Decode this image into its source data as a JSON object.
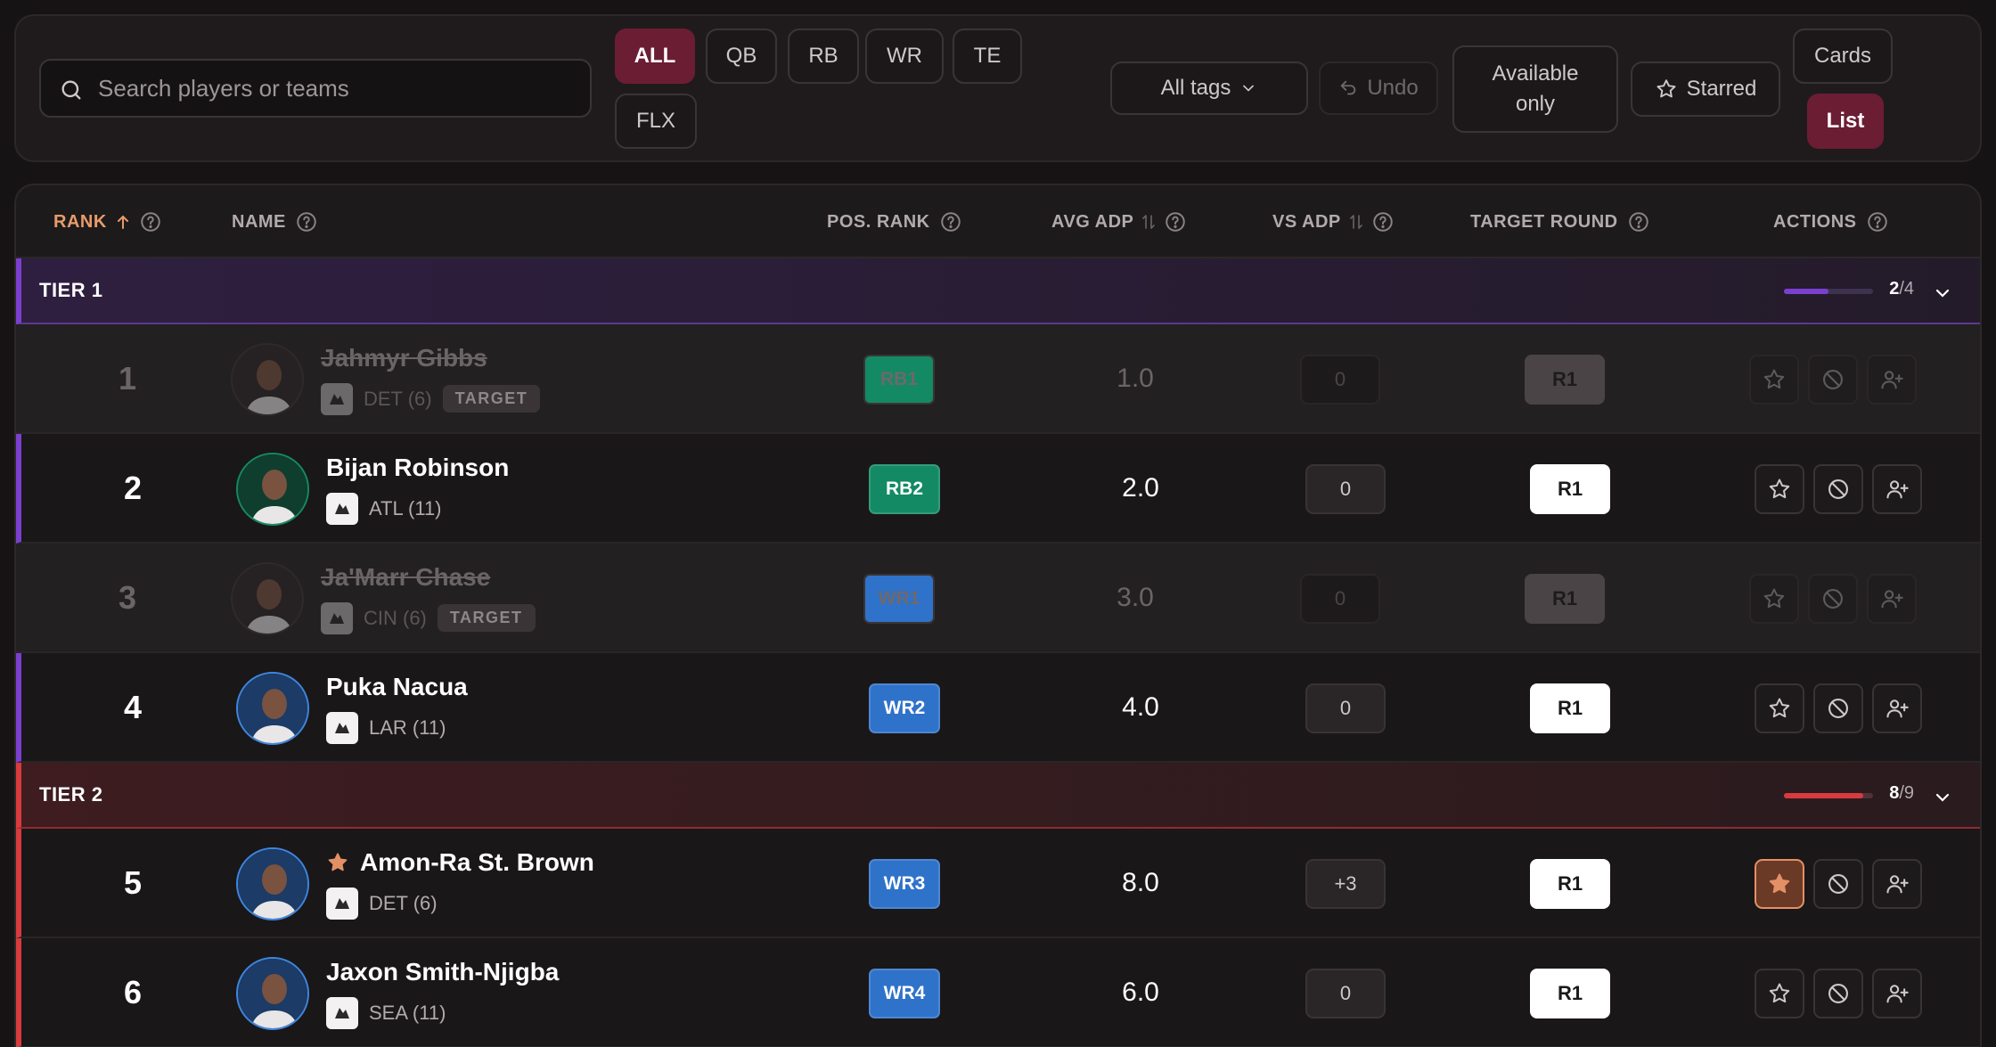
{
  "search": {
    "placeholder": "Search players or teams",
    "icon": "search-icon"
  },
  "filters": {
    "positions": [
      "ALL",
      "QB",
      "RB",
      "WR",
      "TE",
      "FLX"
    ],
    "active": "ALL"
  },
  "toolbar": {
    "tags_label": "All tags",
    "undo_label": "Undo",
    "available_label": "Available only",
    "starred_label": "Starred",
    "view_cards_label": "Cards",
    "view_list_label": "List",
    "active_view": "List"
  },
  "columns": {
    "rank": "RANK",
    "name": "NAME",
    "pos_rank": "POS. RANK",
    "avg_adp": "AVG ADP",
    "vs_adp": "VS ADP",
    "target_round": "TARGET ROUND",
    "actions": "ACTIONS"
  },
  "colors": {
    "accent": "#6b1d34",
    "tier1": "#7b3fd0",
    "tier2": "#d83a3e",
    "rb": "#138a63",
    "wr": "#2f72c9",
    "star": "#e39066"
  },
  "tiers": [
    {
      "label": "TIER 1",
      "drafted": "2",
      "total": "/4",
      "fraction": 0.5,
      "players": [
        {
          "rank": "1",
          "name": "Jahmyr Gibbs",
          "team": "DET (6)",
          "tag": "TARGET",
          "pos": "RB1",
          "adp": "1.0",
          "vs": "0",
          "round": "R1",
          "drafted": true,
          "starred": false
        },
        {
          "rank": "2",
          "name": "Bijan Robinson",
          "team": "ATL (11)",
          "tag": "",
          "pos": "RB2",
          "adp": "2.0",
          "vs": "0",
          "round": "R1",
          "drafted": false,
          "starred": false
        },
        {
          "rank": "3",
          "name": "Ja'Marr Chase",
          "team": "CIN (6)",
          "tag": "TARGET",
          "pos": "WR1",
          "adp": "3.0",
          "vs": "0",
          "round": "R1",
          "drafted": true,
          "starred": false
        },
        {
          "rank": "4",
          "name": "Puka Nacua",
          "team": "LAR (11)",
          "tag": "",
          "pos": "WR2",
          "adp": "4.0",
          "vs": "0",
          "round": "R1",
          "drafted": false,
          "starred": false
        }
      ]
    },
    {
      "label": "TIER 2",
      "drafted": "8",
      "total": "/9",
      "fraction": 0.889,
      "players": [
        {
          "rank": "5",
          "name": "Amon-Ra St. Brown",
          "team": "DET (6)",
          "tag": "",
          "pos": "WR3",
          "adp": "8.0",
          "vs": "+3",
          "round": "R1",
          "drafted": false,
          "starred": true
        },
        {
          "rank": "6",
          "name": "Jaxon Smith-Njigba",
          "team": "SEA (11)",
          "tag": "",
          "pos": "WR4",
          "adp": "6.0",
          "vs": "0",
          "round": "R1",
          "drafted": false,
          "starred": false
        }
      ]
    }
  ]
}
